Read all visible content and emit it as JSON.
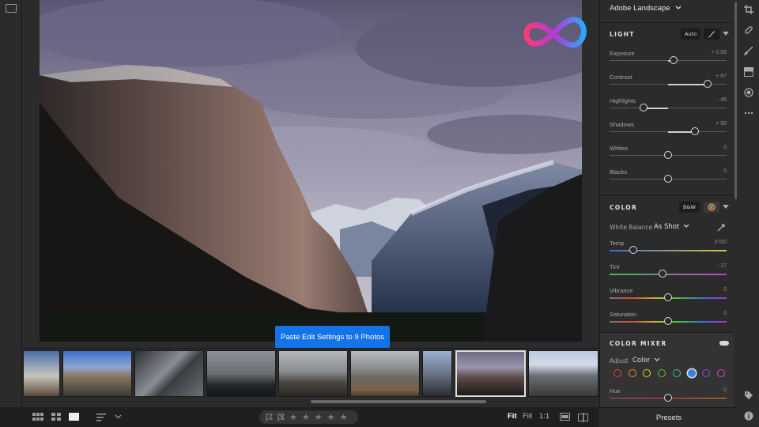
{
  "photo": {
    "paste_button": "Paste Edit Settings to 9 Photos"
  },
  "profile": {
    "label": "Adobe Landscape"
  },
  "light": {
    "title": "LIGHT",
    "auto_label": "Auto",
    "sliders": [
      {
        "label": "Exposure",
        "value": "+ 0.58",
        "level": 0.55,
        "bipolar": true
      },
      {
        "label": "Contrast",
        "value": "+ 67",
        "level": 0.84,
        "bipolar": true
      },
      {
        "label": "Highlights",
        "value": "- 45",
        "level": 0.29,
        "bipolar": true
      },
      {
        "label": "Shadows",
        "value": "+ 50",
        "level": 0.73,
        "bipolar": true
      },
      {
        "label": "Whites",
        "value": "0",
        "level": 0.5,
        "bipolar": true
      },
      {
        "label": "Blacks",
        "value": "0",
        "level": 0.5,
        "bipolar": true
      }
    ]
  },
  "color": {
    "title": "COLOR",
    "bw_label": "B&W",
    "white_balance_label": "White Balance",
    "white_balance_value": "As Shot",
    "sliders": [
      {
        "label": "Temp",
        "value": "3700",
        "level": 0.2,
        "gradient": "linear-gradient(90deg,#3a6fd0,#d8c23a)"
      },
      {
        "label": "Tint",
        "value": "- 17",
        "level": 0.45,
        "gradient": "linear-gradient(90deg,#3bbf4a,#c23bd0)"
      },
      {
        "label": "Vibrance",
        "value": "0",
        "level": 0.5,
        "gradient": "linear-gradient(90deg,#777,#d04a3a,#d0b03a,#3bbf4a,#3a6fd0,#a03ad0)"
      },
      {
        "label": "Saturation",
        "value": "0",
        "level": 0.5,
        "gradient": "linear-gradient(90deg,#777,#d04a3a,#d0b03a,#3bbf4a,#3a6fd0,#a03ad0)"
      }
    ]
  },
  "mixer": {
    "title": "COLOR MIXER",
    "adjust_label": "Adjust",
    "adjust_value": "Color",
    "chips": [
      "#e0452f",
      "#f08a1f",
      "#e8d62a",
      "#58c43c",
      "#2fc4b0",
      "#3a7de8",
      "#8e4ee0",
      "#d04ad0"
    ],
    "selected_chip": 5,
    "hue_label": "Hue",
    "hue_value": "0",
    "hue_level": 0.5
  },
  "zoom": {
    "fit": "Fit",
    "fill": "Fill",
    "one_to_one": "1:1"
  },
  "presets_label": "Presets",
  "colors": {
    "accent": "#1473e6",
    "panel": "#2b2b2b",
    "background": "#1e1e1e"
  }
}
